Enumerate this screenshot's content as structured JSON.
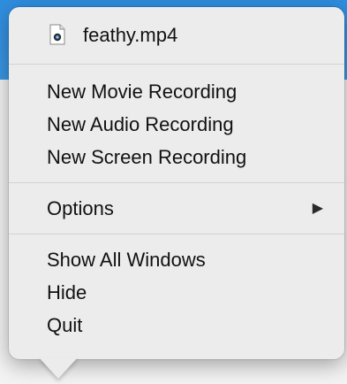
{
  "menu": {
    "file": {
      "icon": "video-file-icon",
      "label": "feathy.mp4"
    },
    "recording_items": [
      {
        "label": "New Movie Recording"
      },
      {
        "label": "New Audio Recording"
      },
      {
        "label": "New Screen Recording"
      }
    ],
    "options": {
      "label": "Options",
      "submenu_indicator": "▶"
    },
    "window_items": [
      {
        "label": "Show All Windows"
      },
      {
        "label": "Hide"
      },
      {
        "label": "Quit"
      }
    ]
  },
  "colors": {
    "menu_background": "#ececec",
    "separator": "#d2d2d2",
    "text": "#111111",
    "backdrop_blue": "#2f8ee0"
  }
}
